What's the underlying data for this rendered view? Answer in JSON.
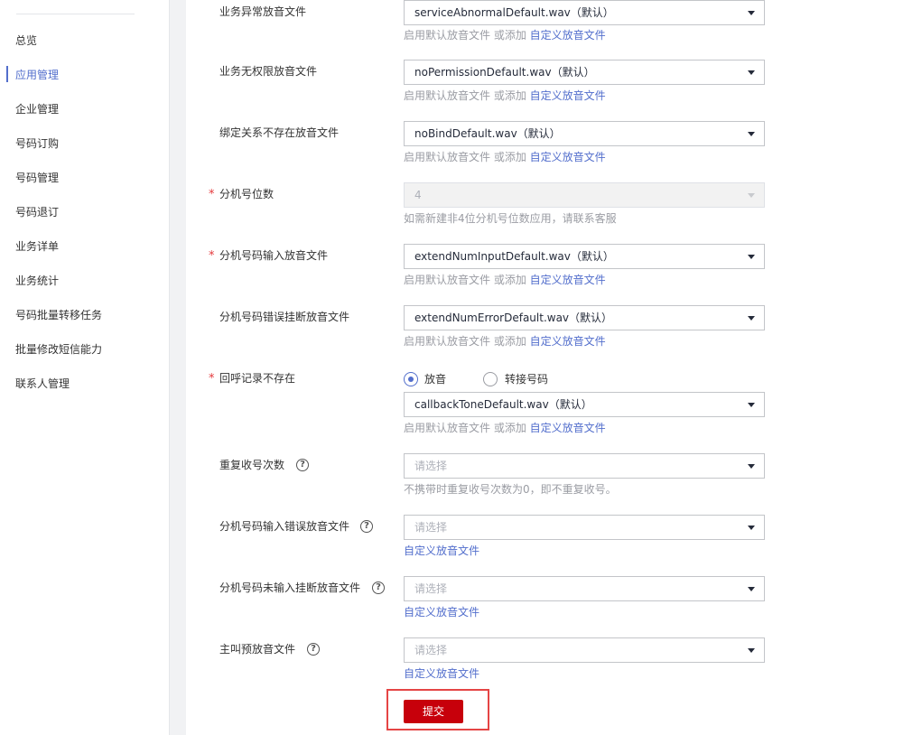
{
  "sidebar": {
    "items": [
      {
        "label": "总览"
      },
      {
        "label": "应用管理",
        "active": true
      },
      {
        "label": "企业管理"
      },
      {
        "label": "号码订购"
      },
      {
        "label": "号码管理"
      },
      {
        "label": "号码退订"
      },
      {
        "label": "业务详单"
      },
      {
        "label": "业务统计"
      },
      {
        "label": "号码批量转移任务"
      },
      {
        "label": "批量修改短信能力"
      },
      {
        "label": "联系人管理"
      }
    ]
  },
  "colors": {
    "accent": "#526ecc",
    "required": "#e4393c",
    "primary_button": "#c7000b",
    "highlight_box": "#e54545",
    "hint_text": "#9a9ca3"
  },
  "icons": {
    "help": "question-circle-icon",
    "dropdown": "caret-down-icon"
  },
  "hints": {
    "default_file_prefix": "启用默认放音文件 或添加",
    "custom_file_link": "自定义放音文件"
  },
  "form": {
    "service_abnormal_tone": {
      "label": "业务异常放音文件",
      "value": "serviceAbnormalDefault.wav（默认）"
    },
    "no_permission_tone": {
      "label": "业务无权限放音文件",
      "value": "noPermissionDefault.wav（默认）"
    },
    "no_bind_tone": {
      "label": "绑定关系不存在放音文件",
      "value": "noBindDefault.wav（默认）"
    },
    "extension_digits": {
      "label": "分机号位数",
      "required": true,
      "value": "4",
      "disabled": true,
      "hint": "如需新建非4位分机号位数应用，请联系客服"
    },
    "extension_input_tone": {
      "label": "分机号码输入放音文件",
      "required": true,
      "value": "extendNumInputDefault.wav（默认）"
    },
    "extension_error_hangup_tone": {
      "label": "分机号码错误挂断放音文件",
      "value": "extendNumErrorDefault.wav（默认）"
    },
    "callback_record_missing": {
      "label": "回呼记录不存在",
      "required": true,
      "options": [
        {
          "label": "放音",
          "checked": true
        },
        {
          "label": "转接号码",
          "checked": false
        }
      ],
      "value": "callbackToneDefault.wav（默认）"
    },
    "repeat_collect_count": {
      "label": "重复收号次数",
      "placeholder": "请选择",
      "hint": "不携带时重复收号次数为0，即不重复收号。"
    },
    "extension_input_error_tone": {
      "label": "分机号码输入错误放音文件",
      "placeholder": "请选择"
    },
    "extension_no_input_hangup_tone": {
      "label": "分机号码未输入挂断放音文件",
      "placeholder": "请选择"
    },
    "caller_pre_tone": {
      "label": "主叫预放音文件",
      "placeholder": "请选择"
    }
  },
  "actions": {
    "submit_label": "提交"
  }
}
